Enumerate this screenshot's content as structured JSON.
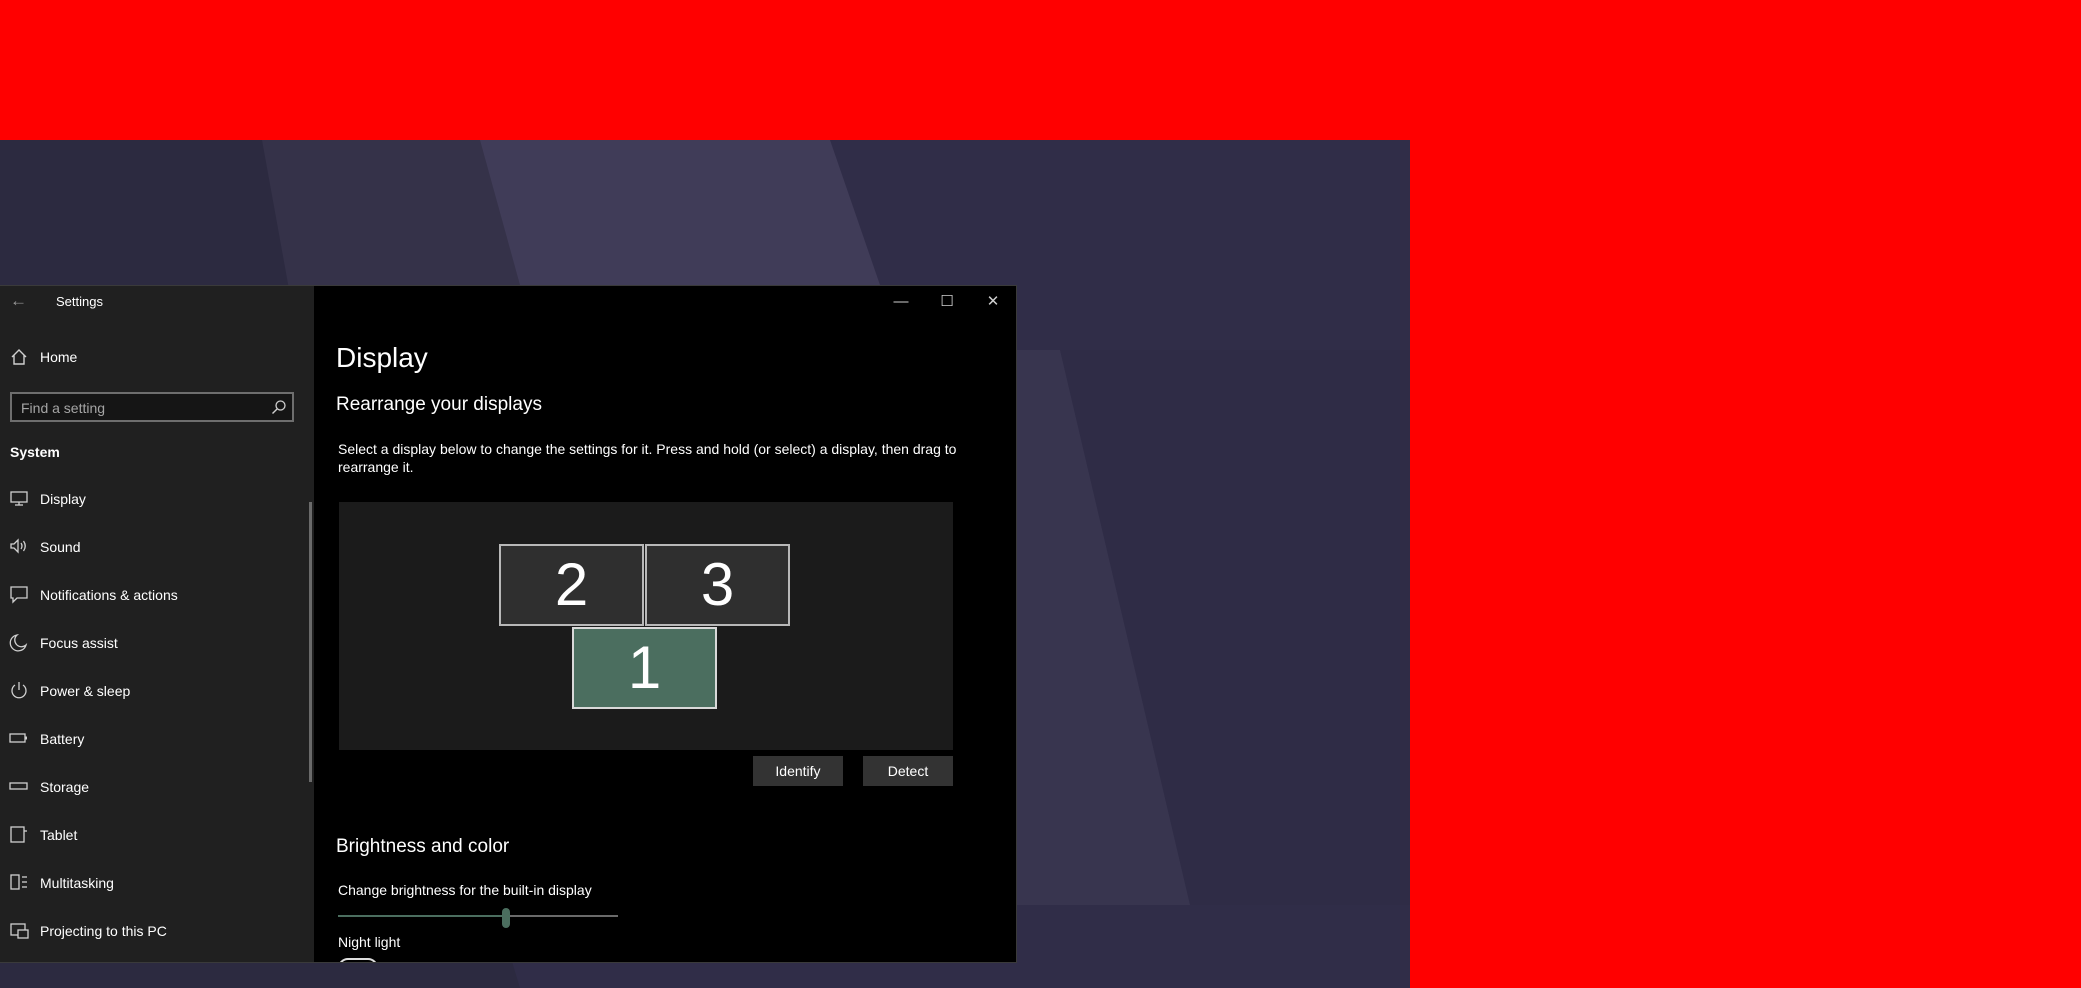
{
  "window": {
    "title": "Settings",
    "controls": [
      "minimize-icon",
      "maximize-icon",
      "close-icon"
    ]
  },
  "sidebar": {
    "home_label": "Home",
    "search_placeholder": "Find a setting",
    "section_label": "System",
    "items": [
      {
        "label": "Display",
        "icon": "monitor-icon"
      },
      {
        "label": "Sound",
        "icon": "speaker-icon"
      },
      {
        "label": "Notifications & actions",
        "icon": "notification-icon"
      },
      {
        "label": "Focus assist",
        "icon": "moon-icon"
      },
      {
        "label": "Power & sleep",
        "icon": "power-icon"
      },
      {
        "label": "Battery",
        "icon": "battery-icon"
      },
      {
        "label": "Storage",
        "icon": "storage-icon"
      },
      {
        "label": "Tablet",
        "icon": "tablet-icon"
      },
      {
        "label": "Multitasking",
        "icon": "multitasking-icon"
      },
      {
        "label": "Projecting to this PC",
        "icon": "projector-icon"
      }
    ]
  },
  "main": {
    "page_title": "Display",
    "rearrange_heading": "Rearrange your displays",
    "rearrange_desc": "Select a display below to change the settings for it. Press and hold (or select) a display, then drag to rearrange it.",
    "monitors": [
      {
        "number": "2",
        "selected": false
      },
      {
        "number": "3",
        "selected": false
      },
      {
        "number": "1",
        "selected": true
      }
    ],
    "identify_label": "Identify",
    "detect_label": "Detect",
    "brightness_heading": "Brightness and color",
    "brightness_label": "Change brightness for the built-in display",
    "brightness_value_percent": 60,
    "night_light_label": "Night light"
  },
  "colors": {
    "accent": "#4b6e5f",
    "sidebar_bg": "#202020",
    "content_bg": "#000000",
    "desktop_bg": "#302d48",
    "outer_bg": "#ff0000"
  }
}
